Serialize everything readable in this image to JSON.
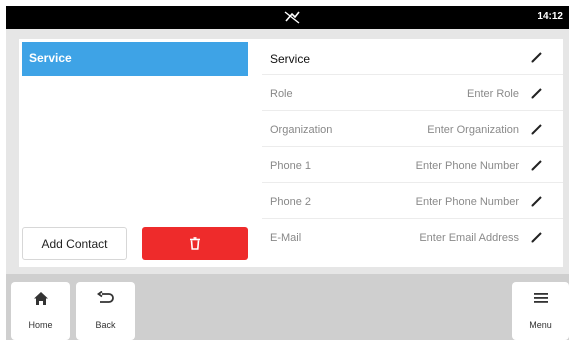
{
  "status_bar": {
    "time": "14:12",
    "center_icon": "muted-signal-icon"
  },
  "contacts_list": {
    "selected_item": "Service",
    "add_button_label": "Add Contact",
    "delete_icon": "trash-icon"
  },
  "detail": {
    "rows": [
      {
        "label": "Service",
        "value": "",
        "edit_icon": "pencil-icon"
      },
      {
        "label": "Role",
        "value": "Enter Role",
        "edit_icon": "pencil-icon"
      },
      {
        "label": "Organization",
        "value": "Enter Organization",
        "edit_icon": "pencil-icon"
      },
      {
        "label": "Phone 1",
        "value": "Enter Phone Number",
        "edit_icon": "pencil-icon"
      },
      {
        "label": "Phone 2",
        "value": "Enter Phone Number",
        "edit_icon": "pencil-icon"
      },
      {
        "label": "E-Mail",
        "value": "Enter Email Address",
        "edit_icon": "pencil-icon"
      }
    ]
  },
  "nav": {
    "home_label": "Home",
    "back_label": "Back",
    "menu_label": "Menu"
  },
  "colors": {
    "selected": "#3ea3e6",
    "delete": "#ee2b2b",
    "background": "#e6e6e6",
    "navbar": "#cfcfcf"
  }
}
